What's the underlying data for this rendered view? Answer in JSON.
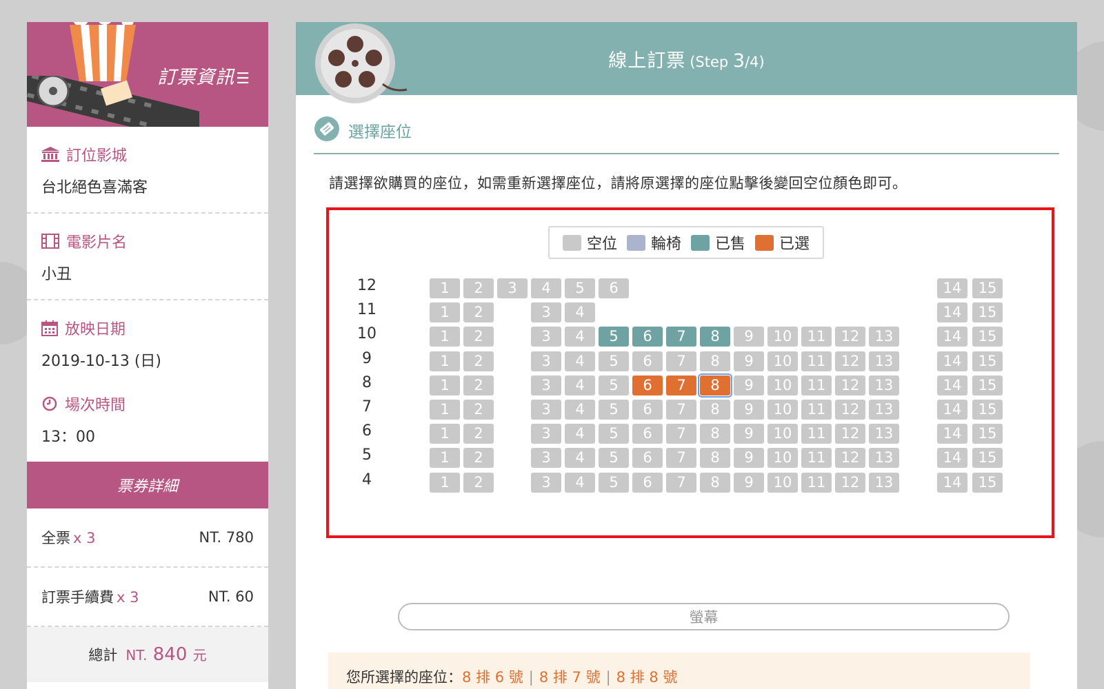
{
  "sidebar": {
    "header_title": "訂票資訊",
    "sections": [
      {
        "label": "訂位影城",
        "value": "台北絕色喜滿客",
        "icon": "building-icon"
      },
      {
        "label": "電影片名",
        "value": "小丑",
        "icon": "film-icon"
      },
      {
        "label": "放映日期",
        "value": "2019-10-13 (日)",
        "icon": "calendar-icon"
      },
      {
        "label": "場次時間",
        "value": "13：00",
        "icon": "clock-icon"
      }
    ],
    "ticket_header": "票券詳細",
    "tickets": [
      {
        "name": "全票",
        "qty": "x 3",
        "price": "NT. 780"
      },
      {
        "name": "訂票手續費",
        "qty": "x 3",
        "price": "NT. 60"
      }
    ],
    "total_label": "總計",
    "total_prefix": "NT.",
    "total_amount": "840",
    "total_unit": "元"
  },
  "main": {
    "title": "線上訂票",
    "step_prefix": "(Step ",
    "step_current": "3",
    "step_suffix": "/4)",
    "section_heading": "選擇座位",
    "instruction": "請選擇欲購買的座位，如需重新選擇座位，請將原選擇的座位點擊後變回空位顏色即可。"
  },
  "legend": [
    {
      "label": "空位",
      "color": "#c9c9c9"
    },
    {
      "label": "輪椅",
      "color": "#aab4cf"
    },
    {
      "label": "已售",
      "color": "#6fa3a3"
    },
    {
      "label": "已選",
      "color": "#e07032"
    }
  ],
  "seat_map": {
    "rows": [
      {
        "label": "12",
        "seats": [
          {
            "n": "1",
            "s": "empty"
          },
          {
            "n": "2",
            "s": "empty"
          },
          {
            "n": "3",
            "s": "empty"
          },
          {
            "n": "4",
            "s": "empty"
          },
          {
            "n": "5",
            "s": "empty"
          },
          {
            "n": "6",
            "s": "empty"
          },
          {
            "n": "14",
            "s": "empty"
          },
          {
            "n": "15",
            "s": "empty"
          }
        ]
      },
      {
        "label": "11",
        "seats": [
          {
            "n": "1",
            "s": "empty"
          },
          {
            "n": "2",
            "s": "empty"
          },
          {
            "n": "3",
            "s": "empty"
          },
          {
            "n": "4",
            "s": "empty"
          },
          {
            "n": "14",
            "s": "empty"
          },
          {
            "n": "15",
            "s": "empty"
          }
        ]
      },
      {
        "label": "10",
        "seats": [
          {
            "n": "1",
            "s": "empty"
          },
          {
            "n": "2",
            "s": "empty"
          },
          {
            "n": "3",
            "s": "empty"
          },
          {
            "n": "4",
            "s": "empty"
          },
          {
            "n": "5",
            "s": "sold"
          },
          {
            "n": "6",
            "s": "sold"
          },
          {
            "n": "7",
            "s": "sold"
          },
          {
            "n": "8",
            "s": "sold"
          },
          {
            "n": "9",
            "s": "empty"
          },
          {
            "n": "10",
            "s": "empty"
          },
          {
            "n": "11",
            "s": "empty"
          },
          {
            "n": "12",
            "s": "empty"
          },
          {
            "n": "13",
            "s": "empty"
          },
          {
            "n": "14",
            "s": "empty"
          },
          {
            "n": "15",
            "s": "empty"
          }
        ]
      },
      {
        "label": "9",
        "seats": [
          {
            "n": "1",
            "s": "empty"
          },
          {
            "n": "2",
            "s": "empty"
          },
          {
            "n": "3",
            "s": "empty"
          },
          {
            "n": "4",
            "s": "empty"
          },
          {
            "n": "5",
            "s": "empty"
          },
          {
            "n": "6",
            "s": "empty"
          },
          {
            "n": "7",
            "s": "empty"
          },
          {
            "n": "8",
            "s": "empty"
          },
          {
            "n": "9",
            "s": "empty"
          },
          {
            "n": "10",
            "s": "empty"
          },
          {
            "n": "11",
            "s": "empty"
          },
          {
            "n": "12",
            "s": "empty"
          },
          {
            "n": "13",
            "s": "empty"
          },
          {
            "n": "14",
            "s": "empty"
          },
          {
            "n": "15",
            "s": "empty"
          }
        ]
      },
      {
        "label": "8",
        "seats": [
          {
            "n": "1",
            "s": "empty"
          },
          {
            "n": "2",
            "s": "empty"
          },
          {
            "n": "3",
            "s": "empty"
          },
          {
            "n": "4",
            "s": "empty"
          },
          {
            "n": "5",
            "s": "empty"
          },
          {
            "n": "6",
            "s": "selected"
          },
          {
            "n": "7",
            "s": "selected"
          },
          {
            "n": "8",
            "s": "selected",
            "focus": true
          },
          {
            "n": "9",
            "s": "empty"
          },
          {
            "n": "10",
            "s": "empty"
          },
          {
            "n": "11",
            "s": "empty"
          },
          {
            "n": "12",
            "s": "empty"
          },
          {
            "n": "13",
            "s": "empty"
          },
          {
            "n": "14",
            "s": "empty"
          },
          {
            "n": "15",
            "s": "empty"
          }
        ]
      },
      {
        "label": "7",
        "seats": [
          {
            "n": "1",
            "s": "empty"
          },
          {
            "n": "2",
            "s": "empty"
          },
          {
            "n": "3",
            "s": "empty"
          },
          {
            "n": "4",
            "s": "empty"
          },
          {
            "n": "5",
            "s": "empty"
          },
          {
            "n": "6",
            "s": "empty"
          },
          {
            "n": "7",
            "s": "empty"
          },
          {
            "n": "8",
            "s": "empty"
          },
          {
            "n": "9",
            "s": "empty"
          },
          {
            "n": "10",
            "s": "empty"
          },
          {
            "n": "11",
            "s": "empty"
          },
          {
            "n": "12",
            "s": "empty"
          },
          {
            "n": "13",
            "s": "empty"
          },
          {
            "n": "14",
            "s": "empty"
          },
          {
            "n": "15",
            "s": "empty"
          }
        ]
      },
      {
        "label": "6",
        "seats": [
          {
            "n": "1",
            "s": "empty"
          },
          {
            "n": "2",
            "s": "empty"
          },
          {
            "n": "3",
            "s": "empty"
          },
          {
            "n": "4",
            "s": "empty"
          },
          {
            "n": "5",
            "s": "empty"
          },
          {
            "n": "6",
            "s": "empty"
          },
          {
            "n": "7",
            "s": "empty"
          },
          {
            "n": "8",
            "s": "empty"
          },
          {
            "n": "9",
            "s": "empty"
          },
          {
            "n": "10",
            "s": "empty"
          },
          {
            "n": "11",
            "s": "empty"
          },
          {
            "n": "12",
            "s": "empty"
          },
          {
            "n": "13",
            "s": "empty"
          },
          {
            "n": "14",
            "s": "empty"
          },
          {
            "n": "15",
            "s": "empty"
          }
        ]
      },
      {
        "label": "5",
        "seats": [
          {
            "n": "1",
            "s": "empty"
          },
          {
            "n": "2",
            "s": "empty"
          },
          {
            "n": "3",
            "s": "empty"
          },
          {
            "n": "4",
            "s": "empty"
          },
          {
            "n": "5",
            "s": "empty"
          },
          {
            "n": "6",
            "s": "empty"
          },
          {
            "n": "7",
            "s": "empty"
          },
          {
            "n": "8",
            "s": "empty"
          },
          {
            "n": "9",
            "s": "empty"
          },
          {
            "n": "10",
            "s": "empty"
          },
          {
            "n": "11",
            "s": "empty"
          },
          {
            "n": "12",
            "s": "empty"
          },
          {
            "n": "13",
            "s": "empty"
          },
          {
            "n": "14",
            "s": "empty"
          },
          {
            "n": "15",
            "s": "empty"
          }
        ]
      },
      {
        "label": "4",
        "seats": [
          {
            "n": "1",
            "s": "empty"
          },
          {
            "n": "2",
            "s": "empty"
          },
          {
            "n": "3",
            "s": "empty"
          },
          {
            "n": "4",
            "s": "empty"
          },
          {
            "n": "5",
            "s": "empty"
          },
          {
            "n": "6",
            "s": "empty"
          },
          {
            "n": "7",
            "s": "empty"
          },
          {
            "n": "8",
            "s": "empty"
          },
          {
            "n": "9",
            "s": "empty"
          },
          {
            "n": "10",
            "s": "empty"
          },
          {
            "n": "11",
            "s": "empty"
          },
          {
            "n": "12",
            "s": "empty"
          },
          {
            "n": "13",
            "s": "empty"
          },
          {
            "n": "14",
            "s": "empty"
          },
          {
            "n": "15",
            "s": "empty"
          }
        ]
      }
    ]
  },
  "screen_label": "螢幕",
  "selected_panel": {
    "label": "您所選擇的座位：",
    "seats": [
      "8 排 6 號",
      "8 排 7 號",
      "8 排 8 號"
    ]
  },
  "colors": {
    "sidebar_accent": "#b85683",
    "header_teal": "#82b1b0",
    "seat_empty": "#c9c9c9",
    "seat_sold": "#6fa3a3",
    "seat_selected": "#e07032",
    "highlight_border": "#e8141b"
  }
}
